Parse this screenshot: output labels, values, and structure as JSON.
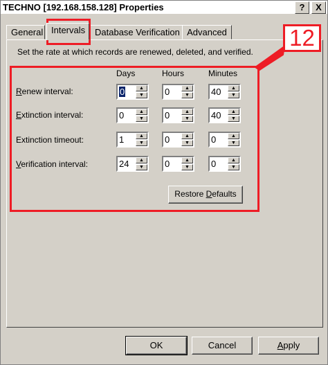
{
  "window": {
    "title": "TECHNO [192.168.158.128] Properties",
    "help_label": "?",
    "close_label": "X"
  },
  "tabs": [
    {
      "label": "General"
    },
    {
      "label": "Intervals"
    },
    {
      "label": "Database Verification"
    },
    {
      "label": "Advanced"
    }
  ],
  "panel": {
    "description": "Set the rate at which records are renewed, deleted, and verified.",
    "columns": [
      "Days",
      "Hours",
      "Minutes"
    ],
    "rows": [
      {
        "label_key": "R",
        "label_rest": "enew interval:",
        "days": "0",
        "hours": "0",
        "minutes": "40"
      },
      {
        "label_key": "E",
        "label_rest": "xtinction interval:",
        "days": "0",
        "hours": "0",
        "minutes": "40"
      },
      {
        "label_key": "",
        "label_rest": "Extinction timeout:",
        "days": "1",
        "hours": "0",
        "minutes": "0"
      },
      {
        "label_key": "V",
        "label_rest": "erification interval:",
        "days": "24",
        "hours": "0",
        "minutes": "0"
      }
    ],
    "restore_prefix": "Restore ",
    "restore_key": "D",
    "restore_suffix": "efaults"
  },
  "annotation": {
    "number": "12",
    "color": "#ee1c25"
  },
  "buttons": {
    "ok": "OK",
    "cancel": "Cancel",
    "apply_key": "A",
    "apply_rest": "pply"
  },
  "icons": [
    "spin-up-icon",
    "spin-down-icon"
  ]
}
